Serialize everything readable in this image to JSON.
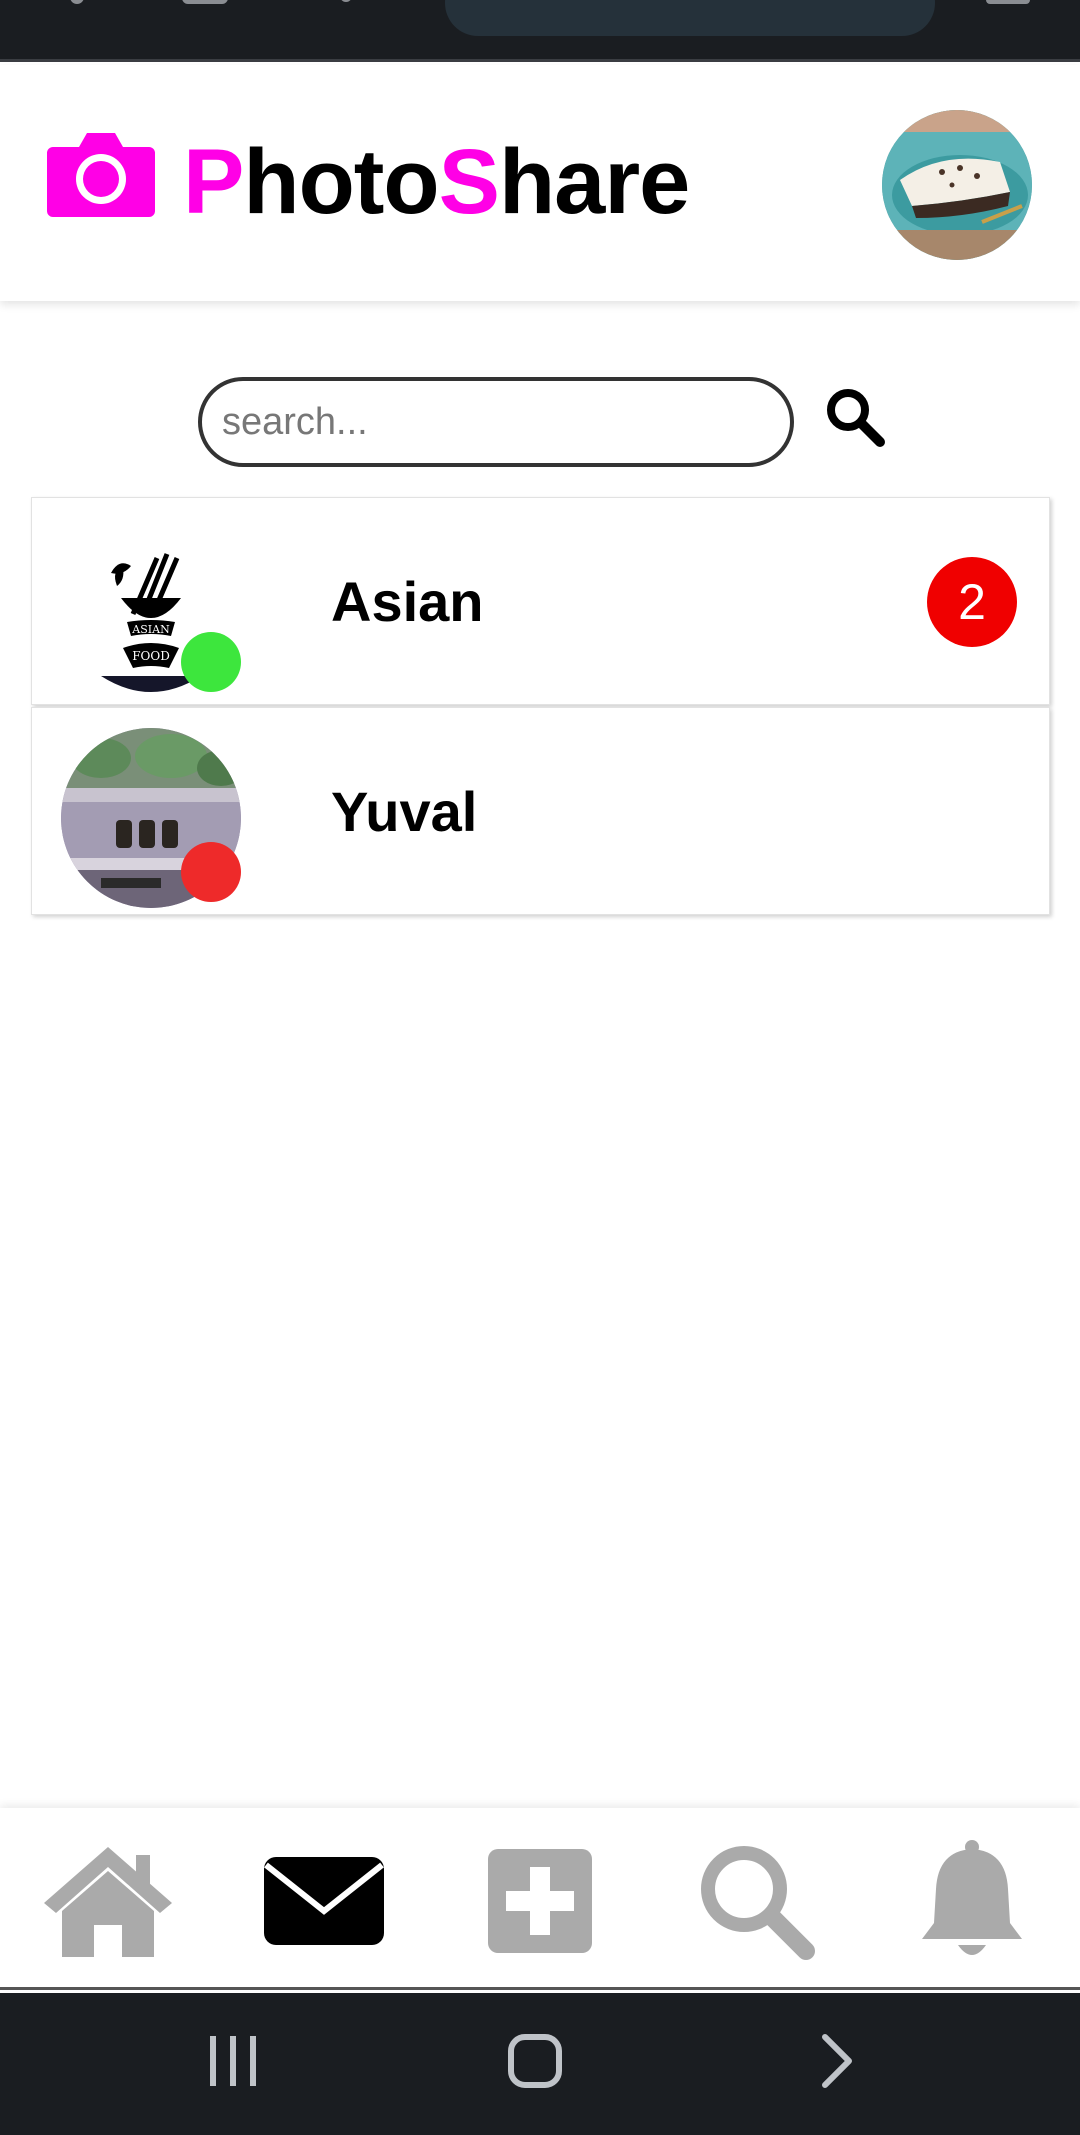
{
  "app": {
    "title_first_accent": "P",
    "title_middle": "hoto",
    "title_second_accent": "S",
    "title_end": "hare"
  },
  "colors": {
    "brand": "#ff00e6",
    "online": "#3de63d",
    "offline": "#ee2a2a",
    "badge": "#f00000",
    "nav_active": "#000000",
    "nav_inactive": "#aaaaaa"
  },
  "search": {
    "value": "",
    "placeholder": "search...",
    "icon": "search-icon"
  },
  "chats": [
    {
      "name": "Asian",
      "status": "online",
      "unread": "2",
      "avatar": "asian-food-logo"
    },
    {
      "name": "Yuval",
      "status": "offline",
      "unread": "",
      "avatar": "user-photo"
    }
  ],
  "nav": {
    "items": [
      {
        "icon": "home-icon",
        "active": false
      },
      {
        "icon": "envelope-icon",
        "active": true
      },
      {
        "icon": "plus-square-icon",
        "active": false
      },
      {
        "icon": "search-icon",
        "active": false
      },
      {
        "icon": "bell-icon",
        "active": false
      }
    ]
  },
  "system_nav": {
    "items": [
      "recent-apps-icon",
      "home-button-icon",
      "back-chevron-icon"
    ]
  }
}
